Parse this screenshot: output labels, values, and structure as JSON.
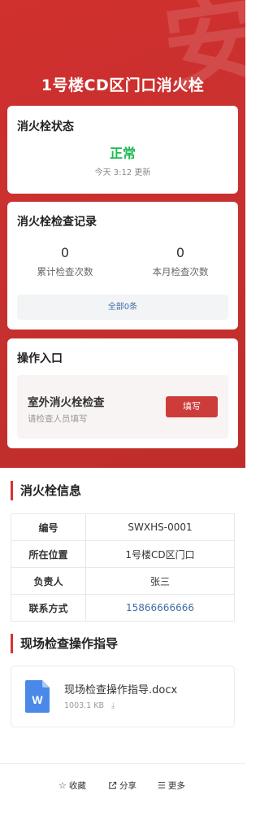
{
  "hero": {
    "title": "1号楼CD区门口消火栓"
  },
  "status": {
    "title": "消火栓状态",
    "value": "正常",
    "time": "今天 3:12 更新",
    "value_color": "#1db954"
  },
  "records": {
    "title": "消火栓检查记录",
    "stats": [
      {
        "value": "0",
        "label": "累计检查次数"
      },
      {
        "value": "0",
        "label": "本月检查次数"
      }
    ],
    "all_label": "全部0条"
  },
  "operations": {
    "title": "操作入口",
    "item_title": "室外消火栓检查",
    "item_subtitle": "请检查人员填写",
    "button_label": "填写"
  },
  "info": {
    "title": "消火栓信息",
    "rows": [
      {
        "key": "编号",
        "value": "SWXHS-0001"
      },
      {
        "key": "所在位置",
        "value": "1号楼CD区门口"
      },
      {
        "key": "负责人",
        "value": "张三"
      },
      {
        "key": "联系方式",
        "value": "15866666666"
      }
    ]
  },
  "guide": {
    "title": "现场检查操作指导",
    "file_name": "现场检查操作指导.docx",
    "file_size": "1003.1 KB",
    "file_icon": "word-doc-icon"
  },
  "bottom_bar": {
    "favorite": "收藏",
    "share": "分享",
    "more": "更多"
  },
  "colors": {
    "brand_red": "#cc3c3a",
    "link_blue": "#3f6ea8"
  }
}
